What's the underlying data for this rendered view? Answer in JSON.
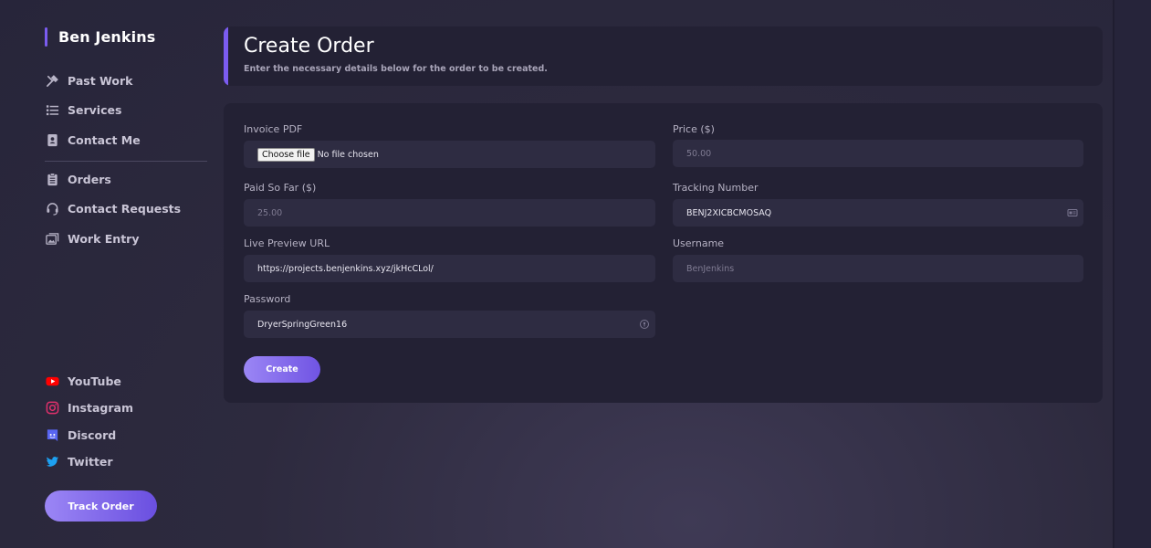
{
  "sidebar": {
    "brand": "Ben Jenkins",
    "nav": [
      {
        "label": "Past Work",
        "icon": "tools-icon"
      },
      {
        "label": "Services",
        "icon": "list-icon"
      },
      {
        "label": "Contact Me",
        "icon": "contact-book-icon"
      },
      {
        "label": "Orders",
        "icon": "clipboard-icon"
      },
      {
        "label": "Contact Requests",
        "icon": "headset-icon"
      },
      {
        "label": "Work Entry",
        "icon": "images-icon"
      }
    ],
    "social": [
      {
        "label": "YouTube",
        "icon": "youtube-icon",
        "color": "#ff0000"
      },
      {
        "label": "Instagram",
        "icon": "instagram-icon",
        "color": "#e1306c"
      },
      {
        "label": "Discord",
        "icon": "discord-icon",
        "color": "#5865f2"
      },
      {
        "label": "Twitter",
        "icon": "twitter-icon",
        "color": "#1da1f2"
      }
    ],
    "track_order": "Track Order"
  },
  "header": {
    "title": "Create Order",
    "subtitle": "Enter the necessary details below for the order to be created."
  },
  "form": {
    "invoice_label": "Invoice PDF",
    "file_button": "Choose file",
    "file_status": "No file chosen",
    "price_label": "Price ($)",
    "price_placeholder": "50.00",
    "paid_label": "Paid So Far ($)",
    "paid_placeholder": "25.00",
    "tracking_label": "Tracking Number",
    "tracking_value": "BENJ2XICBCMOSAQ",
    "preview_label": "Live Preview URL",
    "preview_value": "https://projects.benjenkins.xyz/jkHcCLol/",
    "username_label": "Username",
    "username_placeholder": "BenJenkins",
    "password_label": "Password",
    "password_value": "DryerSpringGreen16",
    "create_button": "Create"
  },
  "colors": {
    "accent": "#7b5cf0",
    "background": "#2d2a3e",
    "card": "#232134",
    "input": "#2e2c42"
  }
}
